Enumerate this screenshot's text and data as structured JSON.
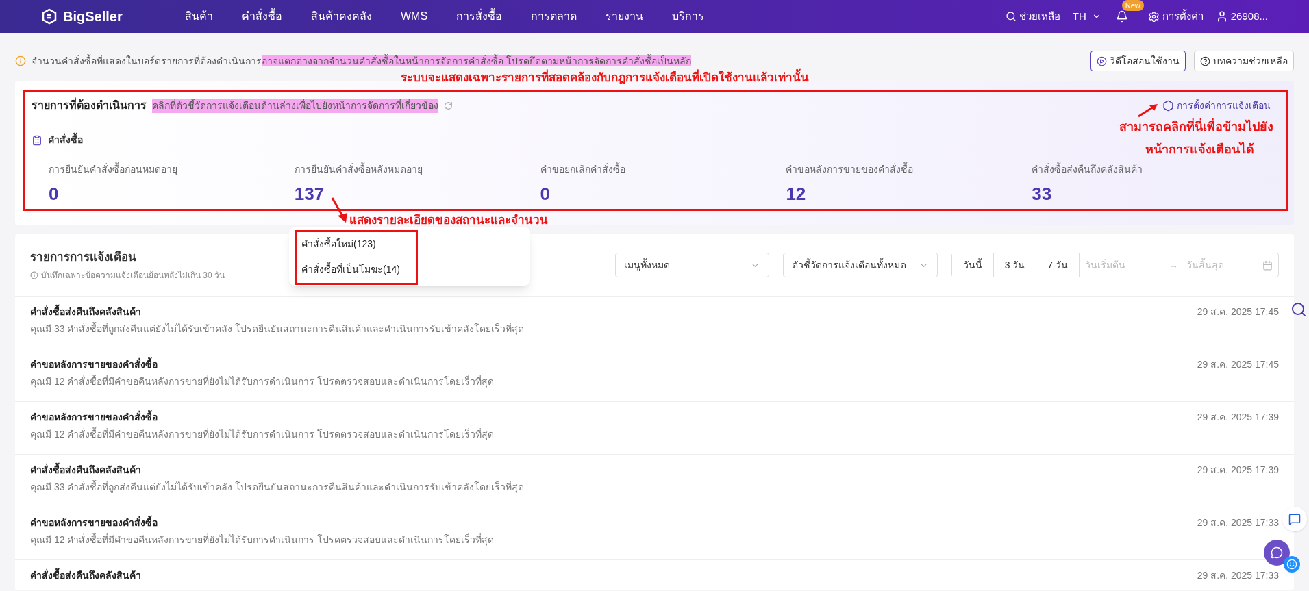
{
  "header": {
    "logo": "BigSeller",
    "nav": [
      "สินค้า",
      "คำสั่งซื้อ",
      "สินค้าคงคลัง",
      "WMS",
      "การสั่งซื้อ",
      "การตลาด",
      "รายงาน",
      "บริการ"
    ],
    "help": "ช่วยเหลือ",
    "language": "TH",
    "badge": "New",
    "settings": "การตั้งค่า",
    "user": "26908..."
  },
  "notice": {
    "text": "จำนวนคำสั่งซื้อที่แสดงในบอร์ดรายการที่ต้องดำเนินการ",
    "highlight": "อาจแตกต่างจากจำนวนคำสั่งซื้อในหน้าการจัดการคำสั่งซื้อ โปรดยึดตามหน้าการจัดการคำสั่งซื้อเป็นหลัก",
    "buttons": [
      "วิดีโอสอนใช้งาน",
      "บทความช่วยเหลือ"
    ]
  },
  "todo": {
    "title": "รายการที่ต้องดำเนินการ",
    "hint": "คลิกที่ตัวชี้วัดการแจ้งเตือนด้านล่างเพื่อไปยังหน้าการจัดการที่เกี่ยวข้อง",
    "settings_link": "การตั้งค่าการแจ้งเตือน",
    "section": "คำสั่งซื้อ",
    "metrics": [
      {
        "label": "การยืนยันคำสั่งซื้อก่อนหมดอายุ",
        "value": "0"
      },
      {
        "label": "การยืนยันคำสั่งซื้อหลังหมดอายุ",
        "value": "137"
      },
      {
        "label": "คำขอยกเลิกคำสั่งซื้อ",
        "value": "0"
      },
      {
        "label": "คำขอหลังการขายของคำสั่งซื้อ",
        "value": "12"
      },
      {
        "label": "คำสั่งซื้อส่งคืนถึงคลังสินค้า",
        "value": "33"
      }
    ]
  },
  "popup": {
    "items": [
      "คำสั่งซื้อใหม่(123)",
      "คำสั่งซื้อที่เป็นโมฆะ(14)"
    ]
  },
  "alerts": {
    "title": "รายการการแจ้งเตือน",
    "subtitle": "บันทึกเฉพาะข้อความแจ้งเตือนย้อนหลังไม่เกิน 30 วัน",
    "menu_select": "เมนูทั้งหมด",
    "metric_select": "ตัวชี้วัดการแจ้งเตือนทั้งหมด",
    "ranges": [
      {
        "label": "วันนี้",
        "selected": false
      },
      {
        "label": "3 วัน",
        "selected": false
      },
      {
        "label": "7 วัน",
        "selected": false
      }
    ],
    "start_placeholder": "วันเริ่มต้น",
    "range_separator": "→",
    "end_placeholder": "วันสิ้นสุด",
    "rows": [
      {
        "title": "คำสั่งซื้อส่งคืนถึงคลังสินค้า",
        "text": "คุณมี 33 คำสั่งซื้อที่ถูกส่งคืนแต่ยังไม่ได้รับเข้าคลัง โปรดยืนยันสถานะการคืนสินค้าและดำเนินการรับเข้าคลังโดยเร็วที่สุด",
        "time": "29 ส.ค. 2025 17:45"
      },
      {
        "title": "คำขอหลังการขายของคำสั่งซื้อ",
        "text": "คุณมี 12 คำสั่งซื้อที่มีคำขอคืนหลังการขายที่ยังไม่ได้รับการดำเนินการ โปรดตรวจสอบและดำเนินการโดยเร็วที่สุด",
        "time": "29 ส.ค. 2025 17:45"
      },
      {
        "title": "คำขอหลังการขายของคำสั่งซื้อ",
        "text": "คุณมี 12 คำสั่งซื้อที่มีคำขอคืนหลังการขายที่ยังไม่ได้รับการดำเนินการ โปรดตรวจสอบและดำเนินการโดยเร็วที่สุด",
        "time": "29 ส.ค. 2025 17:39"
      },
      {
        "title": "คำสั่งซื้อส่งคืนถึงคลังสินค้า",
        "text": "คุณมี 33 คำสั่งซื้อที่ถูกส่งคืนแต่ยังไม่ได้รับเข้าคลัง โปรดยืนยันสถานะการคืนสินค้าและดำเนินการรับเข้าคลังโดยเร็วที่สุด",
        "time": "29 ส.ค. 2025 17:39"
      },
      {
        "title": "คำขอหลังการขายของคำสั่งซื้อ",
        "text": "คุณมี 12 คำสั่งซื้อที่มีคำขอคืนหลังการขายที่ยังไม่ได้รับการดำเนินการ โปรดตรวจสอบและดำเนินการโดยเร็วที่สุด",
        "time": "29 ส.ค. 2025 17:33"
      },
      {
        "title": "คำสั่งซื้อส่งคืนถึงคลังสินค้า",
        "time": "29 ส.ค. 2025 17:33"
      }
    ]
  },
  "annotations": {
    "top": "ระบบจะแสดงเฉพาะรายการที่สอดคล้องกับกฎการแจ้งเตือนที่เปิดใช้งานแล้วเท่านั้น",
    "right": [
      "สามารถคลิกที่นี่เพื่อข้ามไปยัง",
      "หน้าการแจ้งเตือนได้"
    ],
    "middle": "แสดงรายละเอียดของสถานะและจำนวน"
  }
}
